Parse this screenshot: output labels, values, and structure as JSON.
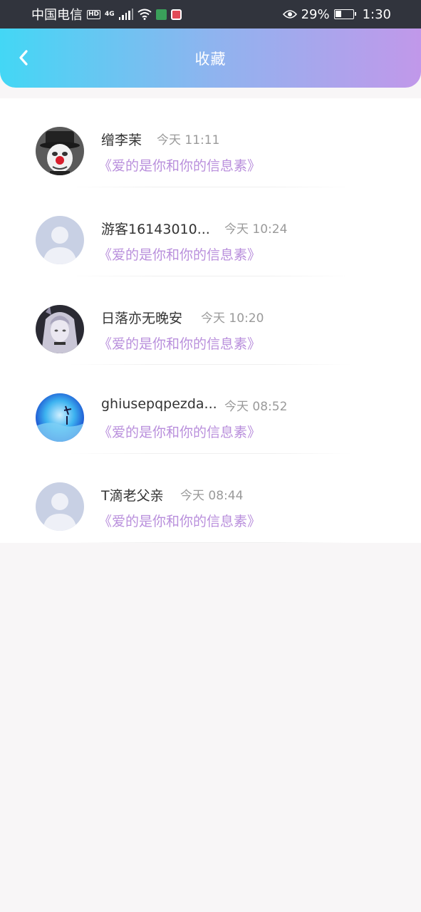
{
  "status_bar": {
    "carrier": "中国电信",
    "hd": "HD",
    "network": "4G",
    "battery": "29%",
    "time": "1:30"
  },
  "header": {
    "title": "收藏"
  },
  "items": [
    {
      "name": "缯李茉",
      "time": "今天 11:11",
      "song": "《爱的是你和你的信息素》",
      "avatar": "clown-avatar"
    },
    {
      "name": "游客16143010...",
      "time": "今天 10:24",
      "song": "《爱的是你和你的信息素》",
      "avatar": "default-avatar"
    },
    {
      "name": "日落亦无晚安",
      "time": "今天 10:20",
      "song": "《爱的是你和你的信息素》",
      "avatar": "anime-girl-avatar"
    },
    {
      "name": "ghiusepqpezda...",
      "time": "今天 08:52",
      "song": "《爱的是你和你的信息素》",
      "avatar": "blue-scenery-avatar"
    },
    {
      "name": "T滴老父亲",
      "time": "今天 08:44",
      "song": "《爱的是你和你的信息素》",
      "avatar": "default-avatar"
    }
  ],
  "colors": {
    "header_gradient_start": "#43d7f5",
    "header_gradient_end": "#c198ea",
    "song_text": "#b98fdc",
    "page_background": "#f8f6f7"
  }
}
